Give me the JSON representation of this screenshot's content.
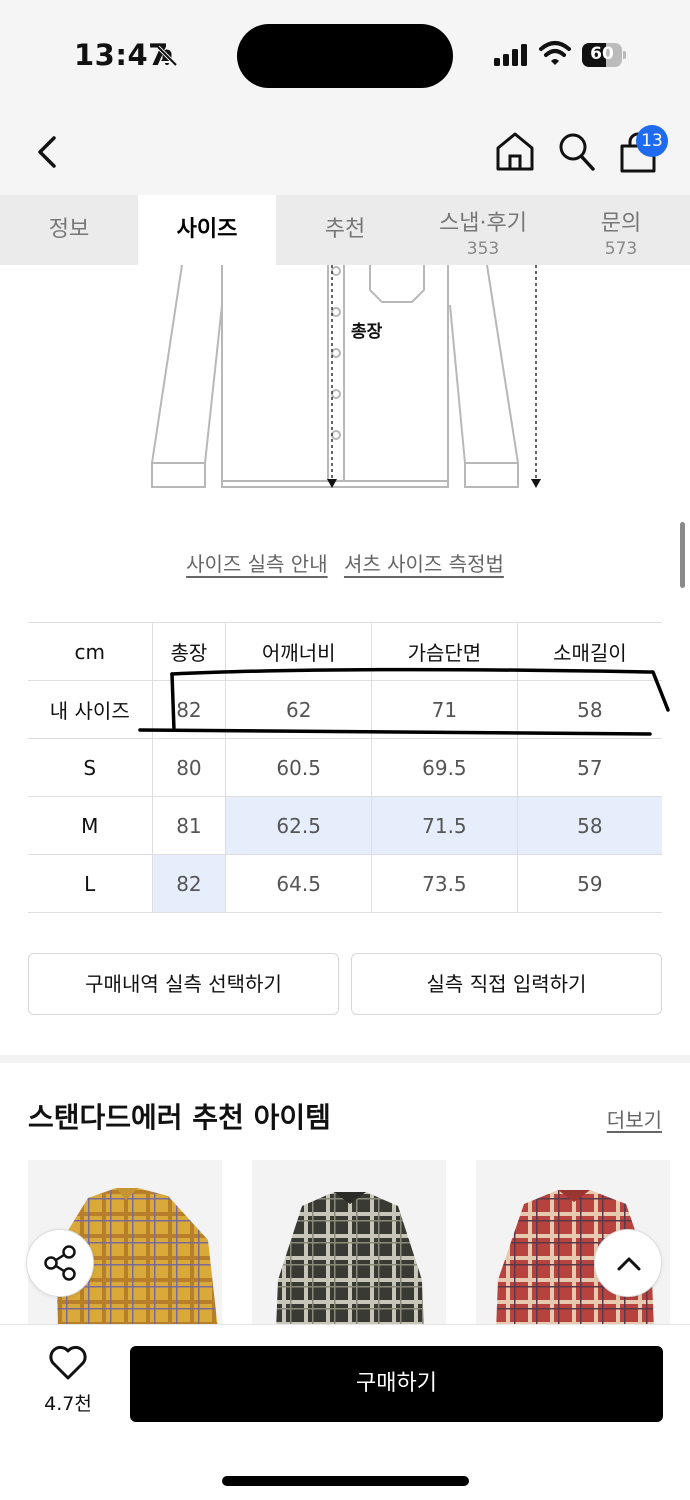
{
  "status_bar": {
    "time": "13:47",
    "battery": "60",
    "battery_level_percent": 60
  },
  "nav": {
    "cart_count": "13"
  },
  "tabs": [
    {
      "label": "정보",
      "count": ""
    },
    {
      "label": "사이즈",
      "count": "",
      "active": true
    },
    {
      "label": "추천",
      "count": ""
    },
    {
      "label": "스냅·후기",
      "count": "353"
    },
    {
      "label": "문의",
      "count": "573"
    }
  ],
  "diagram": {
    "label": "총장"
  },
  "guide_links": [
    "사이즈 실측 안내",
    "셔츠 사이즈 측정법"
  ],
  "size_table": {
    "unit_header": "cm",
    "columns": [
      "총장",
      "어깨너비",
      "가슴단면",
      "소매길이"
    ],
    "rows": [
      {
        "label": "내 사이즈",
        "values": [
          "82",
          "62",
          "71",
          "58"
        ]
      },
      {
        "label": "S",
        "values": [
          "80",
          "60.5",
          "69.5",
          "57"
        ]
      },
      {
        "label": "M",
        "values": [
          "81",
          "62.5",
          "71.5",
          "58"
        ]
      },
      {
        "label": "L",
        "values": [
          "82",
          "64.5",
          "73.5",
          "59"
        ]
      }
    ]
  },
  "buttons": {
    "select_purchase": "구매내역 실측 선택하기",
    "manual_input": "실측 직접 입력하기"
  },
  "recommend": {
    "title": "스탠다드에러 추천 아이템",
    "more": "더보기"
  },
  "bottom_bar": {
    "like_count": "4.7천",
    "buy_label": "구매하기"
  },
  "colors": {
    "highlight": "#e6eefc",
    "badge": "#1f6bf0"
  }
}
